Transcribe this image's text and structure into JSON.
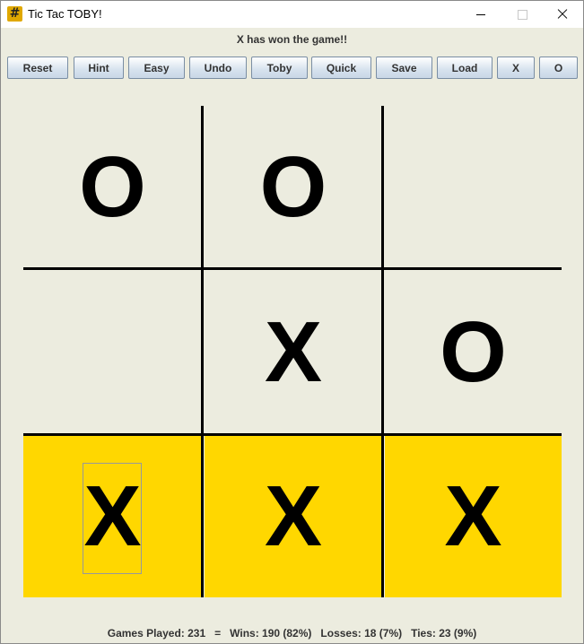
{
  "window": {
    "title": "Tic Tac TOBY!",
    "icon": "hash-icon"
  },
  "status": "X has won the game!!",
  "toolbar": {
    "buttons": [
      "Reset",
      "Hint",
      "Easy",
      "Undo",
      "Toby",
      "Quick",
      "Save",
      "Load",
      "X",
      "O"
    ]
  },
  "board": {
    "cells": [
      "O",
      "O",
      "",
      "",
      "X",
      "O",
      "X",
      "X",
      "X"
    ],
    "winning_cells": [
      6,
      7,
      8
    ],
    "highlight_color": "#FFD700"
  },
  "stats": {
    "text": "Games Played: 231   =   Wins: 190 (82%)   Losses: 18 (7%)   Ties: 23 (9%)"
  }
}
